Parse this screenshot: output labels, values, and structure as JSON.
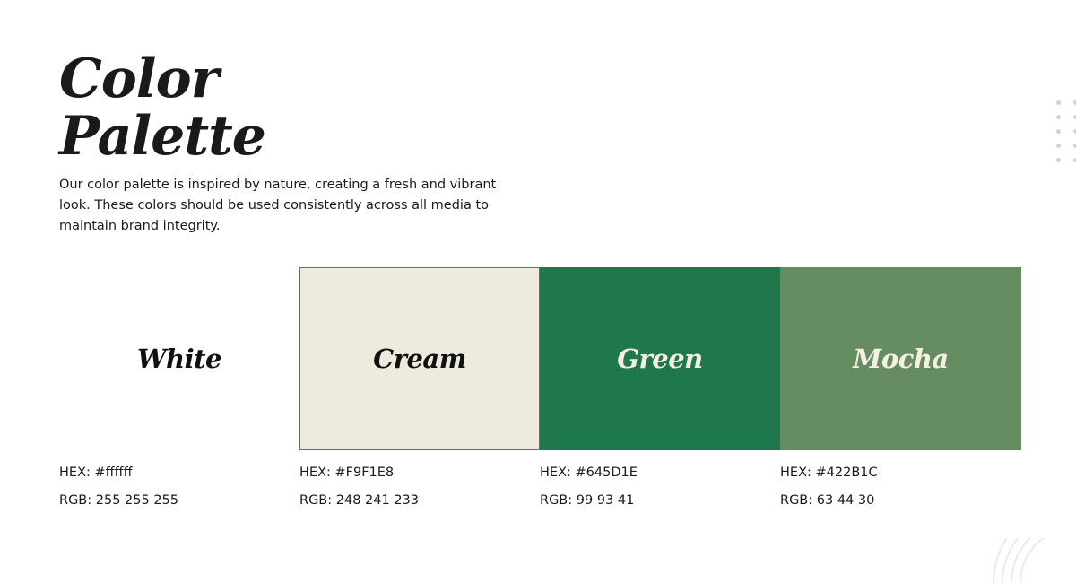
{
  "title_lines": [
    "Color",
    "Palette"
  ],
  "description": "Our color palette is inspired by nature, creating a fresh and vibrant look. These colors should be used consistently across all media to maintain brand integrity.",
  "swatches": [
    {
      "name": "White",
      "color": "#ffffff",
      "hex_text": "HEX: #ffffff",
      "rgb_text": "RGB: 255 255 255"
    },
    {
      "name": "Cream",
      "color": "#edebdd",
      "hex_text": "HEX: #F9F1E8",
      "rgb_text": "RGB: 248 241 233"
    },
    {
      "name": "Green",
      "color": "#1e784c",
      "hex_text": "HEX: #645D1E",
      "rgb_text": "RGB: 99 93 41"
    },
    {
      "name": "Mocha",
      "color": "#658d61",
      "hex_text": "HEX: #422B1C",
      "rgb_text": "RGB: 63 44 30"
    }
  ],
  "decorations": {
    "dot_color": "#d2d2d2",
    "arc_color": "#e6ece8",
    "dot_grid_icon": "dot-grid-icon",
    "arc_icon": "concentric-arcs-icon"
  }
}
